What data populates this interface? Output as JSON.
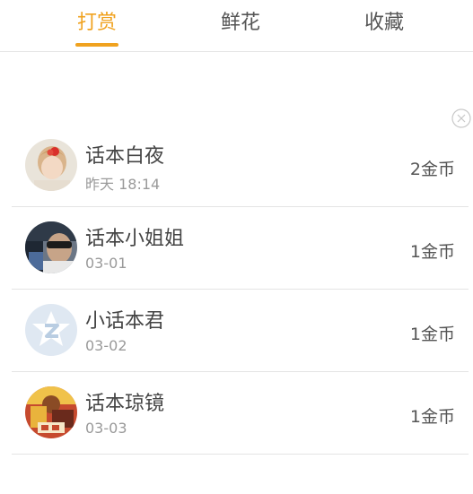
{
  "tabs": [
    {
      "label": "打赏",
      "active": true
    },
    {
      "label": "鲜花",
      "active": false
    },
    {
      "label": "收藏",
      "active": false
    }
  ],
  "accent_color": "#f0a21f",
  "close_icon": "close-circle-icon",
  "rewards": [
    {
      "name": "话本白夜",
      "time": "昨天 18:14",
      "amount": "2金币",
      "avatar": "photo-girl-avatar"
    },
    {
      "name": "话本小姐姐",
      "time": "03-01",
      "amount": "1金币",
      "avatar": "photo-sunglasses-avatar"
    },
    {
      "name": "小话本君",
      "time": "03-02",
      "amount": "1金币",
      "avatar": "star-badge-avatar"
    },
    {
      "name": "话本琼镜",
      "time": "03-03",
      "amount": "1金币",
      "avatar": "book-cover-avatar"
    }
  ]
}
